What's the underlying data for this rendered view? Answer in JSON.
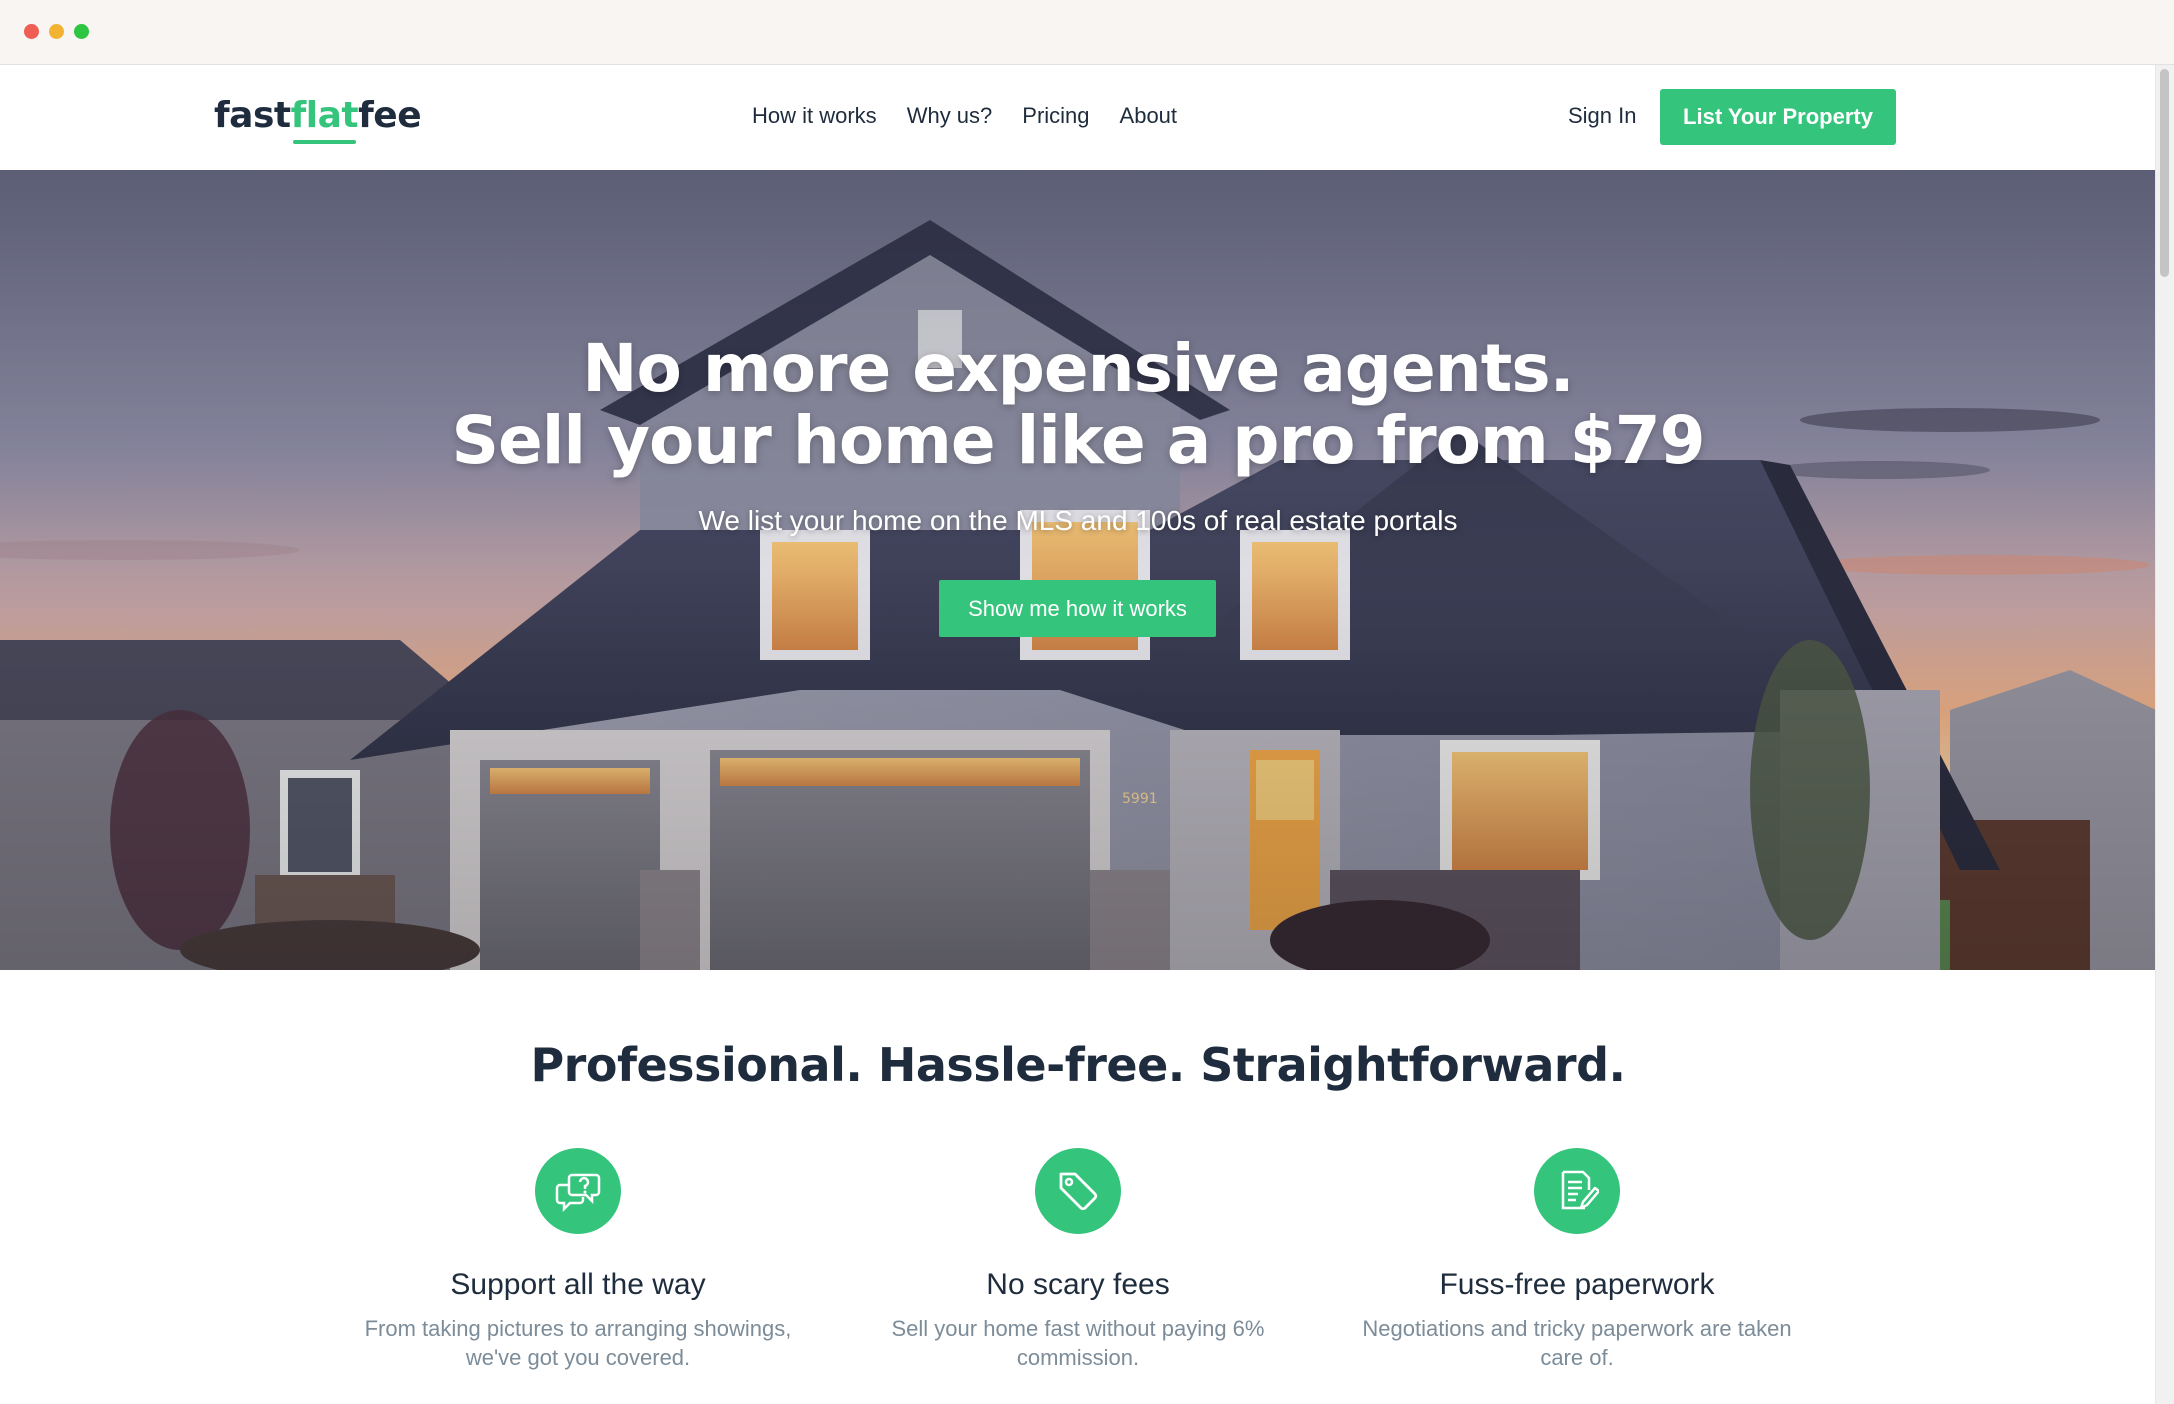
{
  "header": {
    "logo": {
      "part1": "fast",
      "part2": "flat",
      "part3": "fee"
    },
    "nav": [
      "How it works",
      "Why us?",
      "Pricing",
      "About"
    ],
    "sign_in": "Sign In",
    "cta": "List Your Property"
  },
  "hero": {
    "title_line1": "No more expensive agents.",
    "title_line2": "Sell your home like a pro from $79",
    "subtitle": "We list your home on the MLS and 100s of real estate portals",
    "button": "Show me how it works",
    "house_number": "5991"
  },
  "features": {
    "title": "Professional. Hassle-free. Straightforward.",
    "items": [
      {
        "icon": "chat-question-icon",
        "title": "Support all the way",
        "desc_line1": "From taking pictures to arranging showings,",
        "desc_line2": "we've got you covered."
      },
      {
        "icon": "price-tag-icon",
        "title": "No scary fees",
        "desc_line1": "Sell your home fast without paying 6%",
        "desc_line2": "commission."
      },
      {
        "icon": "document-edit-icon",
        "title": "Fuss-free paperwork",
        "desc_line1": "Negotiations and tricky paperwork are taken",
        "desc_line2": "care of."
      }
    ]
  },
  "colors": {
    "accent": "#34c47c",
    "text": "#1e2c3d",
    "muted": "#7c8c99"
  }
}
